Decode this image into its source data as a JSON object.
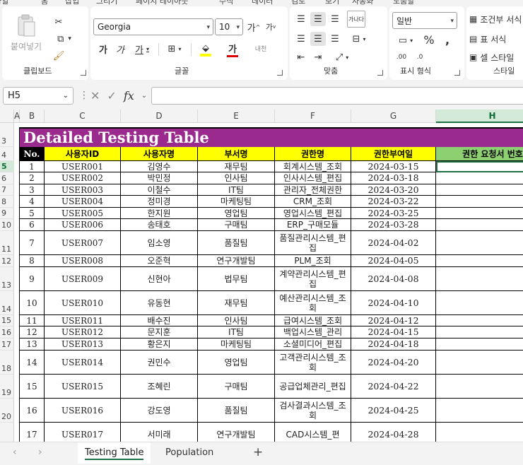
{
  "menu_tabs": [
    "파일",
    "홈",
    "삽입",
    "그리기",
    "페이지 레이아웃",
    "수식",
    "데이터",
    "검토",
    "보기",
    "자동화",
    "도움말"
  ],
  "ribbon": {
    "clipboard": {
      "paste": "붙여넣기",
      "label": "클립보드"
    },
    "font": {
      "name": "Georgia",
      "size": "10",
      "grow": "가",
      "shrink": "가",
      "bold": "가",
      "italic": "가",
      "underline": "가",
      "phonetic": "내천",
      "label": "글꼴"
    },
    "align": {
      "wrap": "가나다",
      "label": "맞춤"
    },
    "number": {
      "format": "일반",
      "label": "표시 형식"
    },
    "styles": {
      "cond": "조건부 서식",
      "table": "표 서식",
      "cell": "셀 스타일",
      "label": "스타일"
    }
  },
  "formula_bar": {
    "name_box": "H5",
    "formula": ""
  },
  "columns": [
    "A",
    "B",
    "C",
    "D",
    "E",
    "F",
    "G",
    "H"
  ],
  "selected_column": "H",
  "rows": [
    "3",
    "4",
    "5",
    "6",
    "7",
    "8",
    "9",
    "10",
    "11",
    "12",
    "13",
    "14",
    "15",
    "16",
    "17",
    "18",
    "19",
    "20"
  ],
  "selected_row": "5",
  "table": {
    "title": "Detailed Testing Table",
    "headers": [
      "No.",
      "사용자ID",
      "사용자명",
      "부서명",
      "권한명",
      "권한부여일",
      "권한 요청서 번호"
    ],
    "rows": [
      [
        "1",
        "USER001",
        "김영수",
        "재무팀",
        "회계시스템_조회",
        "2024-03-15"
      ],
      [
        "2",
        "USER002",
        "박민정",
        "인사팀",
        "인사시스템_편집",
        "2024-03-18"
      ],
      [
        "3",
        "USER003",
        "이철수",
        "IT팀",
        "관리자_전체권한",
        "2024-03-20"
      ],
      [
        "4",
        "USER004",
        "정미경",
        "마케팅팀",
        "CRM_조회",
        "2024-03-22"
      ],
      [
        "5",
        "USER005",
        "한지원",
        "영업팀",
        "영업시스템_편집",
        "2024-03-25"
      ],
      [
        "6",
        "USER006",
        "송태호",
        "구매팀",
        "ERP_구매모듈",
        "2024-03-28"
      ],
      [
        "7",
        "USER007",
        "임소영",
        "품질팀",
        "품질관리시스템_편집",
        "2024-04-02"
      ],
      [
        "8",
        "USER008",
        "오준혁",
        "연구개발팀",
        "PLM_조회",
        "2024-04-05"
      ],
      [
        "9",
        "USER009",
        "신현아",
        "법무팀",
        "계약관리시스템_편집",
        "2024-04-08"
      ],
      [
        "10",
        "USER010",
        "유동현",
        "재무팀",
        "예산관리시스템_조회",
        "2024-04-10"
      ],
      [
        "11",
        "USER011",
        "배수진",
        "인사팀",
        "급여시스템_조회",
        "2024-04-12"
      ],
      [
        "12",
        "USER012",
        "문지훈",
        "IT팀",
        "백업시스템_관리",
        "2024-04-15"
      ],
      [
        "13",
        "USER013",
        "황은지",
        "마케팅팀",
        "소셜미디어_편집",
        "2024-04-18"
      ],
      [
        "14",
        "USER014",
        "권민수",
        "영업팀",
        "고객관리시스템_조회",
        "2024-04-20"
      ],
      [
        "15",
        "USER015",
        "조혜린",
        "구매팀",
        "공급업체관리_편집",
        "2024-04-22"
      ],
      [
        "16",
        "USER016",
        "강도영",
        "품질팀",
        "검사결과시스템_조회",
        "2024-04-25"
      ],
      [
        "17",
        "USER017",
        "서미래",
        "연구개발팀",
        "CAD시스템_편",
        "2024-04-28"
      ]
    ]
  },
  "colors": {
    "title_bg": "#9b2a8f",
    "header_bg": "#ffff00",
    "hdr_selected_bg": "#8dd071",
    "accent": "#1e7145"
  },
  "sheet_tabs": [
    "Testing Table",
    "Population"
  ],
  "active_sheet": "Testing Table",
  "add_sheet": "+"
}
